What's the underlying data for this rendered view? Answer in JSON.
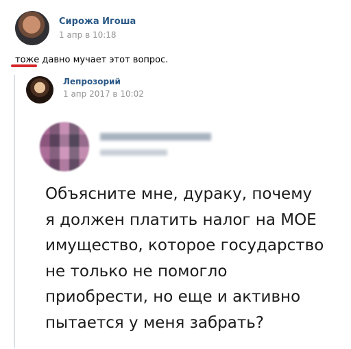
{
  "post": {
    "author": "Сирожа Игоша",
    "date": "1 апр в 10:18",
    "text": "тоже давно мучает этот вопрос."
  },
  "repost": {
    "author": "Лепрозорий",
    "date": "1 апр 2017 в 10:02",
    "image_text": "Объясните мне, дураку, почему\nя должен платить налог на МОЕ\nимущество, которое государство\nне только не помогло\nприобрести, но еще и активно\nпытается у меня забрать?"
  },
  "colors": {
    "link": "#2a5885",
    "meta": "#939393",
    "underline": "#d6292c",
    "repost_bar": "#dae1e8"
  }
}
